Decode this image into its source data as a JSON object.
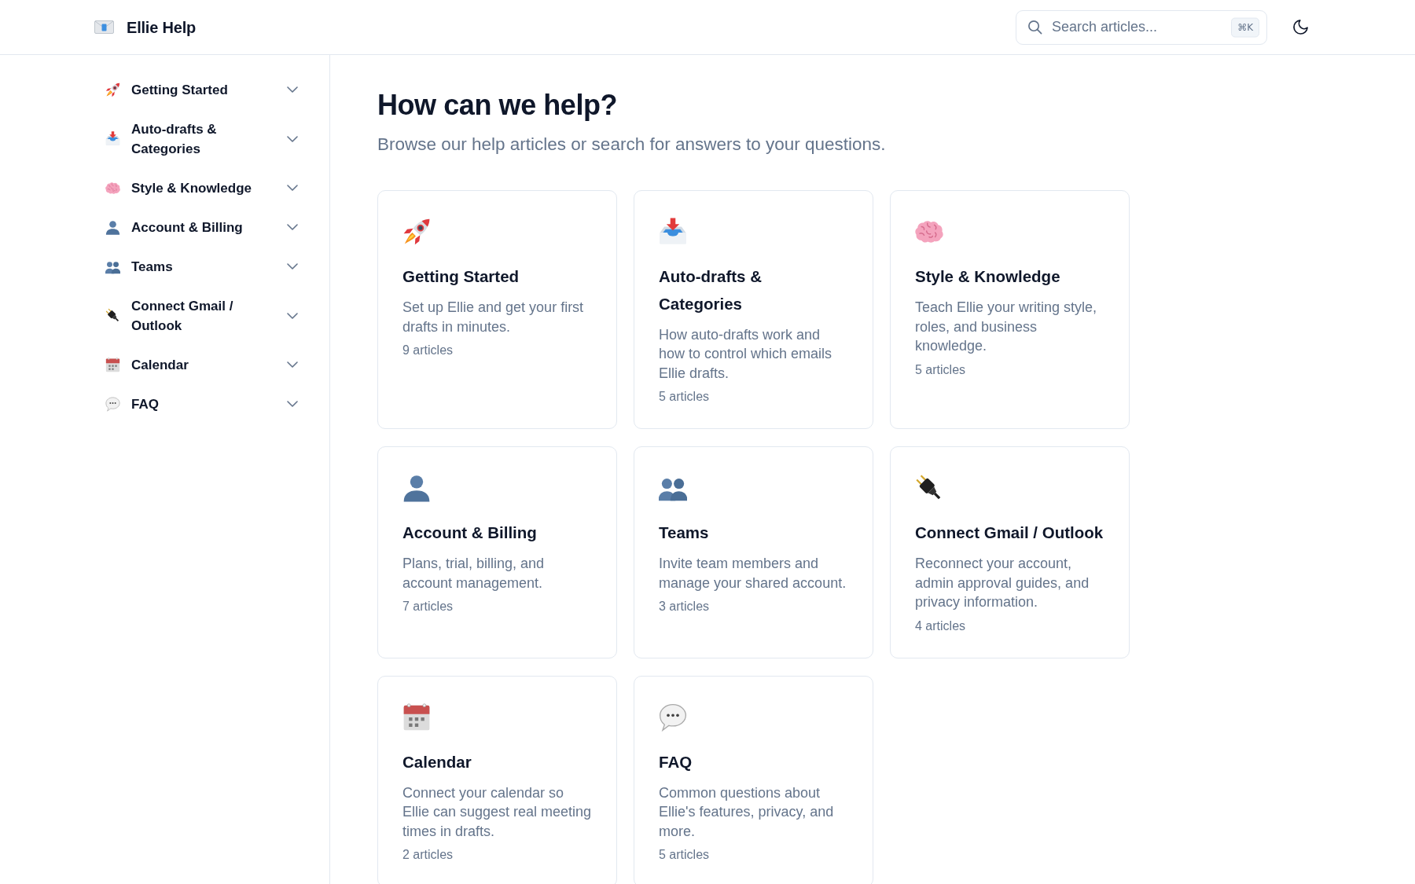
{
  "header": {
    "brand": "Ellie Help",
    "search": {
      "placeholder": "Search articles...",
      "shortcut": "⌘K"
    }
  },
  "sidebar": {
    "items": [
      {
        "label": "Getting Started",
        "expanded": false
      },
      {
        "label": "Auto-drafts & Categories",
        "expanded": false
      },
      {
        "label": "Style & Knowledge",
        "expanded": false
      },
      {
        "label": "Account & Billing",
        "expanded": false
      },
      {
        "label": "Teams",
        "expanded": false
      },
      {
        "label": "Connect Gmail / Outlook",
        "expanded": false
      },
      {
        "label": "Calendar",
        "expanded": false
      },
      {
        "label": "FAQ",
        "expanded": false
      }
    ]
  },
  "main": {
    "title": "How can we help?",
    "subtitle": "Browse our help articles or search for answers to your questions.",
    "categories": [
      {
        "title": "Getting Started",
        "description": "Set up Ellie and get your first drafts in minutes.",
        "count": "9 articles"
      },
      {
        "title": "Auto-drafts & Categories",
        "description": "How auto-drafts work and how to control which emails Ellie drafts.",
        "count": "5 articles"
      },
      {
        "title": "Style & Knowledge",
        "description": "Teach Ellie your writing style, roles, and business knowledge.",
        "count": "5 articles"
      },
      {
        "title": "Account & Billing",
        "description": "Plans, trial, billing, and account management.",
        "count": "7 articles"
      },
      {
        "title": "Teams",
        "description": "Invite team members and manage your shared account.",
        "count": "3 articles"
      },
      {
        "title": "Connect Gmail / Outlook",
        "description": "Reconnect your account, admin approval guides, and privacy information.",
        "count": "4 articles"
      },
      {
        "title": "Calendar",
        "description": "Connect your calendar so Ellie can suggest real meeting times in drafts.",
        "count": "2 articles"
      },
      {
        "title": "FAQ",
        "description": "Common questions about Ellie's features, privacy, and more.",
        "count": "5 articles"
      }
    ]
  }
}
